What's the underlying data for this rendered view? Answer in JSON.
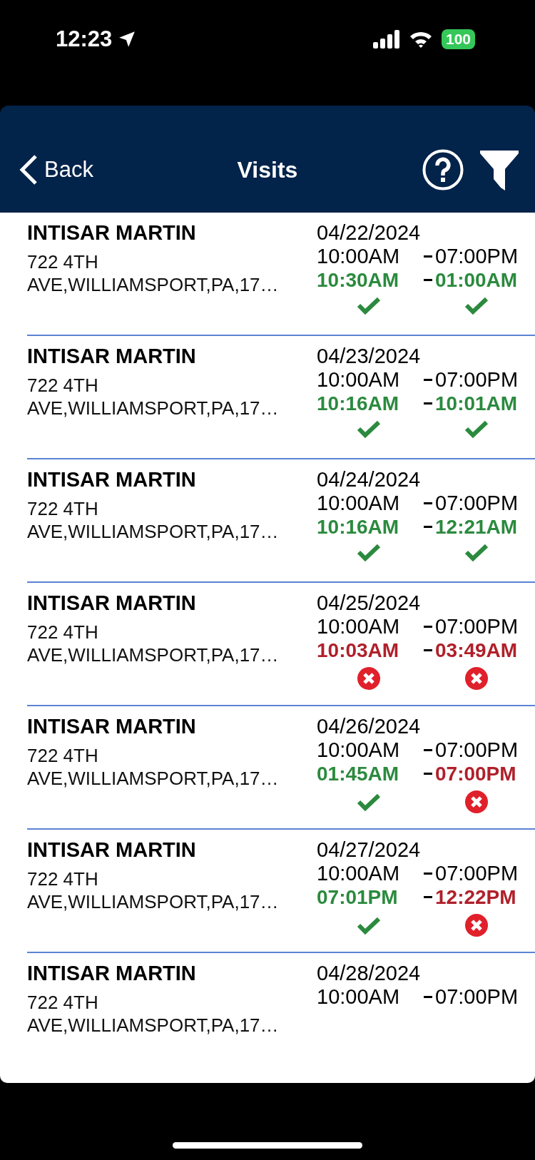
{
  "status_bar": {
    "time": "12:23",
    "battery": "100"
  },
  "header": {
    "back": "Back",
    "title": "Visits"
  },
  "visits": [
    {
      "name": "INTISAR MARTIN",
      "address": [
        "722 4TH",
        "AVE,WILLIAMSPORT,PA,17…"
      ],
      "date": "04/22/2024",
      "scheduled": {
        "start": "10:00AM",
        "end": "07:00PM"
      },
      "actual": [
        {
          "time": "10:30AM",
          "valid": true
        },
        {
          "time": "01:00AM",
          "valid": true
        }
      ]
    },
    {
      "name": "INTISAR MARTIN",
      "address": [
        "722 4TH",
        "AVE,WILLIAMSPORT,PA,17…"
      ],
      "date": "04/23/2024",
      "scheduled": {
        "start": "10:00AM",
        "end": "07:00PM"
      },
      "actual": [
        {
          "time": "10:16AM",
          "valid": true
        },
        {
          "time": "10:01AM",
          "valid": true
        }
      ]
    },
    {
      "name": "INTISAR MARTIN",
      "address": [
        "722 4TH",
        "AVE,WILLIAMSPORT,PA,17…"
      ],
      "date": "04/24/2024",
      "scheduled": {
        "start": "10:00AM",
        "end": "07:00PM"
      },
      "actual": [
        {
          "time": "10:16AM",
          "valid": true
        },
        {
          "time": "12:21AM",
          "valid": true
        }
      ]
    },
    {
      "name": "INTISAR MARTIN",
      "address": [
        "722 4TH",
        "AVE,WILLIAMSPORT,PA,17…"
      ],
      "date": "04/25/2024",
      "scheduled": {
        "start": "10:00AM",
        "end": "07:00PM"
      },
      "actual": [
        {
          "time": "10:03AM",
          "valid": false
        },
        {
          "time": "03:49AM",
          "valid": false
        }
      ]
    },
    {
      "name": "INTISAR MARTIN",
      "address": [
        "722 4TH",
        "AVE,WILLIAMSPORT,PA,17…"
      ],
      "date": "04/26/2024",
      "scheduled": {
        "start": "10:00AM",
        "end": "07:00PM"
      },
      "actual": [
        {
          "time": "01:45AM",
          "valid": true
        },
        {
          "time": "07:00PM",
          "valid": false
        }
      ]
    },
    {
      "name": "INTISAR MARTIN",
      "address": [
        "722 4TH",
        "AVE,WILLIAMSPORT,PA,17…"
      ],
      "date": "04/27/2024",
      "scheduled": {
        "start": "10:00AM",
        "end": "07:00PM"
      },
      "actual": [
        {
          "time": "07:01PM",
          "valid": true
        },
        {
          "time": "12:22PM",
          "valid": false
        }
      ]
    },
    {
      "name": "INTISAR MARTIN",
      "address": [
        "722 4TH",
        "AVE,WILLIAMSPORT,PA,17…"
      ],
      "date": "04/28/2024",
      "scheduled": {
        "start": "10:00AM",
        "end": "07:00PM"
      }
    }
  ]
}
